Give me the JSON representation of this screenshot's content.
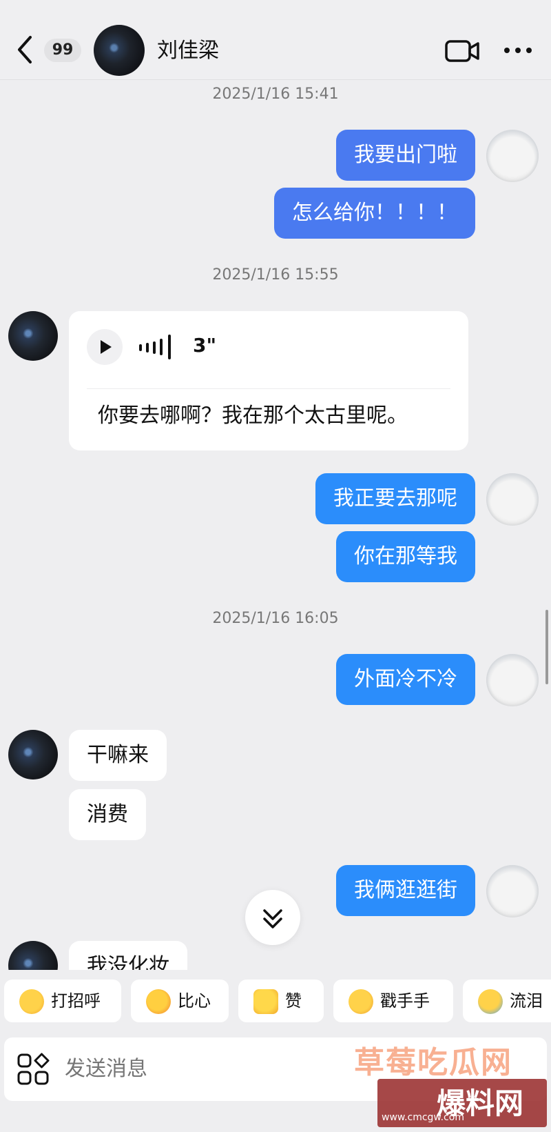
{
  "header": {
    "back_icon": "chevron-left-icon",
    "unread_badge": "99",
    "contact_name": "刘佳梁",
    "video_icon": "video-camera-icon",
    "more_icon": "more-dots-icon"
  },
  "chat": {
    "timestamps": [
      "2025/1/16 15:41",
      "2025/1/16 15:55",
      "2025/1/16 16:05"
    ],
    "messages": [
      {
        "from": "me",
        "text": "我要出门啦"
      },
      {
        "from": "me",
        "text": "怎么给你！！！！"
      },
      {
        "from": "them",
        "type": "voice",
        "duration": "3\"",
        "transcript": "你要去哪啊？我在那个太古里呢。"
      },
      {
        "from": "me",
        "text": "我正要去那呢"
      },
      {
        "from": "me",
        "text": "你在那等我"
      },
      {
        "from": "me",
        "text": "外面冷不冷"
      },
      {
        "from": "them",
        "text": "干嘛来"
      },
      {
        "from": "them",
        "text": "消费"
      },
      {
        "from": "me",
        "text": "我俩逛逛街"
      },
      {
        "from": "them",
        "text": "我没化妆"
      }
    ],
    "scroll_down_icon": "double-chevron-down-icon"
  },
  "quick_reactions": [
    {
      "label": "打招呼",
      "icon": "wave-emoji-icon"
    },
    {
      "label": "比心",
      "icon": "heart-hands-emoji-icon"
    },
    {
      "label": "赞",
      "icon": "thumbs-up-emoji-icon"
    },
    {
      "label": "戳手手",
      "icon": "poke-emoji-icon"
    },
    {
      "label": "流泪",
      "icon": "crying-emoji-icon"
    }
  ],
  "input": {
    "placeholder": "发送消息",
    "apps_icon": "apps-grid-icon"
  },
  "watermark": {
    "line1": "草莓吃瓜网",
    "line2": "爆料网",
    "line3": "www.cmcgw.com"
  },
  "colors": {
    "outgoing_bubble": "#2b8dfb",
    "incoming_bubble": "#ffffff",
    "background": "#eeeef0"
  }
}
